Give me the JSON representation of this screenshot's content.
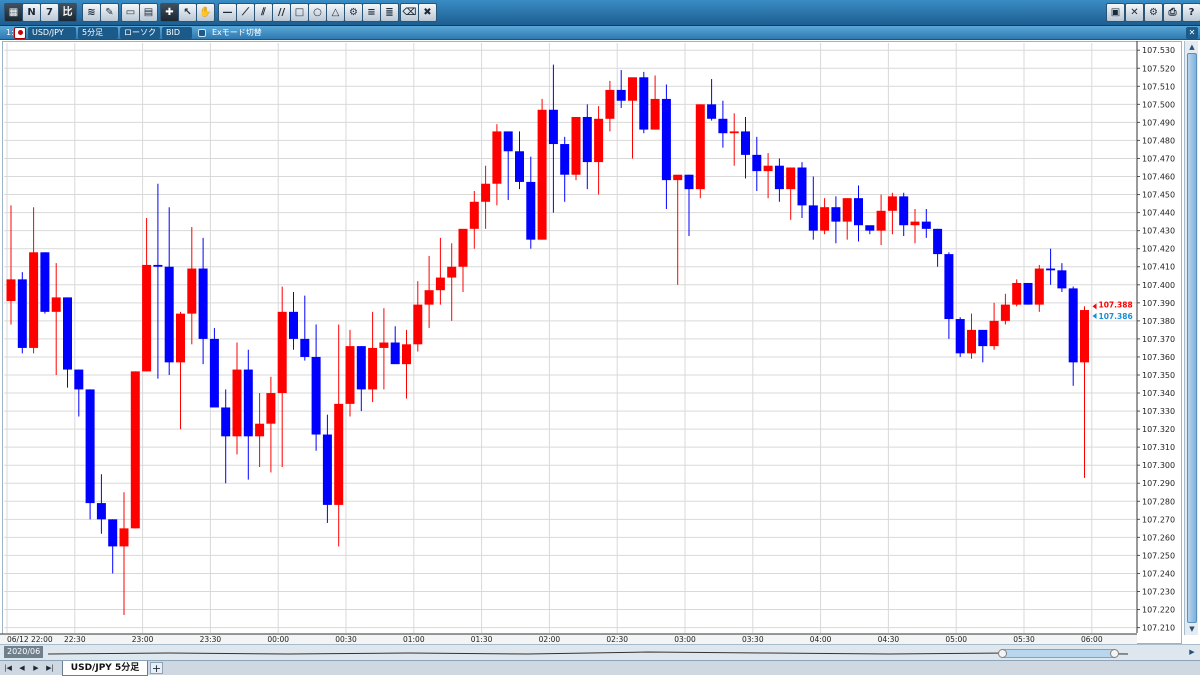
{
  "toolbar": {
    "buttons": [
      {
        "name": "logo-icon",
        "glyph": "▦"
      },
      {
        "name": "news-icon",
        "glyph": "N"
      },
      {
        "name": "calendar-icon",
        "glyph": "7"
      },
      {
        "name": "compare-icon",
        "glyph": "比"
      },
      {
        "name": "line-style-icon",
        "glyph": "≋"
      },
      {
        "name": "pen-icon",
        "glyph": "✎"
      },
      {
        "name": "window-icon",
        "glyph": "▭"
      },
      {
        "name": "save-icon",
        "glyph": "▤"
      },
      {
        "name": "crosshair-icon",
        "glyph": "✚"
      },
      {
        "name": "cursor-icon",
        "glyph": "↖"
      },
      {
        "name": "hand-icon",
        "glyph": "✋"
      },
      {
        "name": "hline-icon",
        "glyph": "—"
      },
      {
        "name": "trendline-icon",
        "glyph": "⟋"
      },
      {
        "name": "channel-icon",
        "glyph": "⫽"
      },
      {
        "name": "parallel-icon",
        "glyph": "//"
      },
      {
        "name": "rectangle-icon",
        "glyph": "□"
      },
      {
        "name": "circle-icon",
        "glyph": "○"
      },
      {
        "name": "triangle-icon",
        "glyph": "△"
      },
      {
        "name": "fibonacci-icon",
        "glyph": "⚙"
      },
      {
        "name": "lines-icon",
        "glyph": "≡"
      },
      {
        "name": "gann-icon",
        "glyph": "≣"
      },
      {
        "name": "eraser-icon",
        "glyph": "⌫"
      },
      {
        "name": "delete-all-icon",
        "glyph": "✖"
      }
    ],
    "right_buttons": [
      {
        "name": "window-layout-icon",
        "glyph": "▣"
      },
      {
        "name": "tile-icon",
        "glyph": "✕"
      },
      {
        "name": "settings-icon",
        "glyph": "⚙"
      },
      {
        "name": "print-icon",
        "glyph": "⎙"
      },
      {
        "name": "help-icon",
        "glyph": "?"
      }
    ]
  },
  "symbol_bar": {
    "index": "1:",
    "symbol": "USD/JPY",
    "timeframe": "5分足",
    "chart_type": "ローソク",
    "price_type": "BID",
    "ex_mode": "Exモード切替"
  },
  "scrollbar": {
    "date": "2020/06"
  },
  "tabs": {
    "active": "USD/JPY 5分足",
    "nav": [
      "|◀",
      "◀",
      "▶",
      "▶|"
    ],
    "add": "+"
  },
  "chart_data": {
    "type": "candlestick",
    "y_ticks": [
      "107.530",
      "107.520",
      "107.510",
      "107.500",
      "107.490",
      "107.480",
      "107.470",
      "107.460",
      "107.450",
      "107.440",
      "107.430",
      "107.420",
      "107.410",
      "107.400",
      "107.390",
      "107.380",
      "107.370",
      "107.360",
      "107.350",
      "107.340",
      "107.330",
      "107.320",
      "107.310",
      "107.300",
      "107.290",
      "107.280",
      "107.270",
      "107.260",
      "107.250",
      "107.240",
      "107.230",
      "107.220",
      "107.210"
    ],
    "ylim": [
      107.207,
      107.534
    ],
    "x_labels": [
      {
        "i": 0,
        "label": "06/12 22:00"
      },
      {
        "i": 6,
        "label": "22:30"
      },
      {
        "i": 12,
        "label": "23:00"
      },
      {
        "i": 18,
        "label": "23:30"
      },
      {
        "i": 24,
        "label": "00:00"
      },
      {
        "i": 30,
        "label": "00:30"
      },
      {
        "i": 36,
        "label": "01:00"
      },
      {
        "i": 42,
        "label": "01:30"
      },
      {
        "i": 48,
        "label": "02:00"
      },
      {
        "i": 54,
        "label": "02:30"
      },
      {
        "i": 60,
        "label": "03:00"
      },
      {
        "i": 66,
        "label": "03:30"
      },
      {
        "i": 72,
        "label": "04:00"
      },
      {
        "i": 78,
        "label": "04:30"
      },
      {
        "i": 84,
        "label": "05:00"
      },
      {
        "i": 90,
        "label": "05:30"
      },
      {
        "i": 96,
        "label": "06:00"
      }
    ],
    "colors": {
      "up": "#ff0000",
      "down": "#0000ff",
      "bid_label": "#ff0000",
      "ask_label": "#1a8fd6",
      "grid": "#d9d9d9"
    },
    "bid_label": "107.388",
    "ask_label": "107.386",
    "candles": [
      [
        107.391,
        107.444,
        107.378,
        107.403
      ],
      [
        107.403,
        107.407,
        107.362,
        107.365
      ],
      [
        107.365,
        107.443,
        107.362,
        107.418
      ],
      [
        107.418,
        107.418,
        107.384,
        107.385
      ],
      [
        107.385,
        107.412,
        107.35,
        107.393
      ],
      [
        107.393,
        107.393,
        107.343,
        107.353
      ],
      [
        107.353,
        107.353,
        107.327,
        107.342
      ],
      [
        107.342,
        107.342,
        107.27,
        107.279
      ],
      [
        107.279,
        107.295,
        107.262,
        107.27
      ],
      [
        107.27,
        107.27,
        107.24,
        107.255
      ],
      [
        107.255,
        107.285,
        107.217,
        107.265
      ],
      [
        107.265,
        107.352,
        107.265,
        107.352
      ],
      [
        107.352,
        107.437,
        107.352,
        107.411
      ],
      [
        107.411,
        107.456,
        107.348,
        107.41
      ],
      [
        107.41,
        107.443,
        107.35,
        107.357
      ],
      [
        107.357,
        107.385,
        107.32,
        107.384
      ],
      [
        107.384,
        107.432,
        107.367,
        107.409
      ],
      [
        107.409,
        107.426,
        107.356,
        107.37
      ],
      [
        107.37,
        107.376,
        107.34,
        107.332
      ],
      [
        107.332,
        107.342,
        107.29,
        107.316
      ],
      [
        107.316,
        107.368,
        107.306,
        107.353
      ],
      [
        107.353,
        107.364,
        107.292,
        107.316
      ],
      [
        107.316,
        107.34,
        107.299,
        107.323
      ],
      [
        107.323,
        107.349,
        107.296,
        107.34
      ],
      [
        107.34,
        107.399,
        107.299,
        107.385
      ],
      [
        107.385,
        107.396,
        107.364,
        107.37
      ],
      [
        107.37,
        107.394,
        107.358,
        107.36
      ],
      [
        107.36,
        107.378,
        107.308,
        107.317
      ],
      [
        107.317,
        107.328,
        107.268,
        107.278
      ],
      [
        107.278,
        107.378,
        107.255,
        107.334
      ],
      [
        107.334,
        107.375,
        107.327,
        107.366
      ],
      [
        107.366,
        107.366,
        107.33,
        107.342
      ],
      [
        107.342,
        107.385,
        107.335,
        107.365
      ],
      [
        107.365,
        107.387,
        107.342,
        107.368
      ],
      [
        107.368,
        107.377,
        107.357,
        107.356
      ],
      [
        107.356,
        107.375,
        107.337,
        107.367
      ],
      [
        107.367,
        107.402,
        107.363,
        107.389
      ],
      [
        107.389,
        107.416,
        107.376,
        107.397
      ],
      [
        107.397,
        107.426,
        107.389,
        107.404
      ],
      [
        107.404,
        107.423,
        107.38,
        107.41
      ],
      [
        107.41,
        107.43,
        107.396,
        107.431
      ],
      [
        107.431,
        107.452,
        107.42,
        107.446
      ],
      [
        107.446,
        107.466,
        107.431,
        107.456
      ],
      [
        107.456,
        107.489,
        107.444,
        107.485
      ],
      [
        107.485,
        107.484,
        107.447,
        107.474
      ],
      [
        107.474,
        107.485,
        107.453,
        107.457
      ],
      [
        107.457,
        107.471,
        107.42,
        107.425
      ],
      [
        107.425,
        107.503,
        107.425,
        107.497
      ],
      [
        107.497,
        107.522,
        107.44,
        107.478
      ],
      [
        107.478,
        107.482,
        107.446,
        107.461
      ],
      [
        107.461,
        107.493,
        107.458,
        107.493
      ],
      [
        107.493,
        107.5,
        107.453,
        107.468
      ],
      [
        107.468,
        107.499,
        107.45,
        107.492
      ],
      [
        107.492,
        107.513,
        107.485,
        107.508
      ],
      [
        107.508,
        107.519,
        107.498,
        107.502
      ],
      [
        107.502,
        107.513,
        107.47,
        107.515
      ],
      [
        107.515,
        107.518,
        107.484,
        107.486
      ],
      [
        107.486,
        107.516,
        107.486,
        107.503
      ],
      [
        107.503,
        107.511,
        107.442,
        107.458
      ],
      [
        107.458,
        107.46,
        107.4,
        107.461
      ],
      [
        107.461,
        107.461,
        107.427,
        107.453
      ],
      [
        107.453,
        107.5,
        107.448,
        107.5
      ],
      [
        107.5,
        107.514,
        107.491,
        107.492
      ],
      [
        107.492,
        107.502,
        107.476,
        107.484
      ],
      [
        107.484,
        107.495,
        107.466,
        107.485
      ],
      [
        107.485,
        107.493,
        107.459,
        107.472
      ],
      [
        107.472,
        107.482,
        107.452,
        107.463
      ],
      [
        107.463,
        107.473,
        107.448,
        107.466
      ],
      [
        107.466,
        107.47,
        107.446,
        107.453
      ],
      [
        107.453,
        107.463,
        107.436,
        107.465
      ],
      [
        107.465,
        107.468,
        107.437,
        107.444
      ],
      [
        107.444,
        107.46,
        107.425,
        107.43
      ],
      [
        107.43,
        107.448,
        107.428,
        107.443
      ],
      [
        107.443,
        107.449,
        107.423,
        107.435
      ],
      [
        107.435,
        107.448,
        107.425,
        107.448
      ],
      [
        107.448,
        107.455,
        107.424,
        107.433
      ],
      [
        107.433,
        107.432,
        107.428,
        107.43
      ],
      [
        107.43,
        107.45,
        107.422,
        107.441
      ],
      [
        107.441,
        107.451,
        107.428,
        107.449
      ],
      [
        107.449,
        107.451,
        107.427,
        107.433
      ],
      [
        107.433,
        107.442,
        107.423,
        107.435
      ],
      [
        107.435,
        107.442,
        107.426,
        107.431
      ],
      [
        107.431,
        107.431,
        107.41,
        107.417
      ],
      [
        107.417,
        107.418,
        107.37,
        107.381
      ],
      [
        107.381,
        107.382,
        107.36,
        107.362
      ],
      [
        107.362,
        107.384,
        107.359,
        107.375
      ],
      [
        107.375,
        107.373,
        107.357,
        107.366
      ],
      [
        107.366,
        107.39,
        107.364,
        107.38
      ],
      [
        107.38,
        107.395,
        107.378,
        107.389
      ],
      [
        107.389,
        107.403,
        107.388,
        107.401
      ],
      [
        107.401,
        107.4,
        107.389,
        107.389
      ],
      [
        107.389,
        107.411,
        107.385,
        107.409
      ],
      [
        107.409,
        107.42,
        107.4,
        107.408
      ],
      [
        107.408,
        107.412,
        107.396,
        107.398
      ],
      [
        107.398,
        107.399,
        107.344,
        107.357
      ],
      [
        107.357,
        107.388,
        107.293,
        107.386
      ]
    ]
  }
}
